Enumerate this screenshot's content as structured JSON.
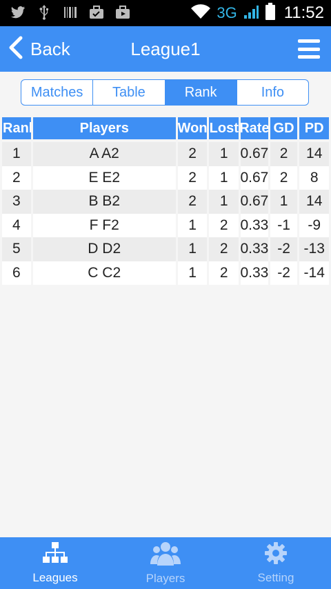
{
  "status_bar": {
    "network": "3G",
    "time": "11:52",
    "icons": [
      "twitter-icon",
      "usb-icon",
      "barcode-icon",
      "briefcase-check-icon",
      "briefcase-play-icon",
      "wifi-icon",
      "signal-icon",
      "battery-icon"
    ]
  },
  "header": {
    "back_label": "Back",
    "title": "League1"
  },
  "tabs": [
    {
      "label": "Matches",
      "active": false
    },
    {
      "label": "Table",
      "active": false
    },
    {
      "label": "Rank",
      "active": true
    },
    {
      "label": "Info",
      "active": false
    }
  ],
  "table": {
    "columns": [
      "Rank",
      "Players",
      "Won",
      "Lost",
      "Rate",
      "GD",
      "PD"
    ],
    "rows": [
      {
        "rank": "1",
        "player": "A A2",
        "won": "2",
        "lost": "1",
        "rate": "0.67",
        "gd": "2",
        "pd": "14"
      },
      {
        "rank": "2",
        "player": "E E2",
        "won": "2",
        "lost": "1",
        "rate": "0.67",
        "gd": "2",
        "pd": "8"
      },
      {
        "rank": "3",
        "player": "B B2",
        "won": "2",
        "lost": "1",
        "rate": "0.67",
        "gd": "1",
        "pd": "14"
      },
      {
        "rank": "4",
        "player": "F F2",
        "won": "1",
        "lost": "2",
        "rate": "0.33",
        "gd": "-1",
        "pd": "-9"
      },
      {
        "rank": "5",
        "player": "D D2",
        "won": "1",
        "lost": "2",
        "rate": "0.33",
        "gd": "-2",
        "pd": "-13"
      },
      {
        "rank": "6",
        "player": "C C2",
        "won": "1",
        "lost": "2",
        "rate": "0.33",
        "gd": "-2",
        "pd": "-14"
      }
    ]
  },
  "bottom_nav": [
    {
      "label": "Leagues",
      "icon": "hierarchy-icon",
      "active": true
    },
    {
      "label": "Players",
      "icon": "people-icon",
      "active": false
    },
    {
      "label": "Setting",
      "icon": "gear-icon",
      "active": false
    }
  ],
  "colors": {
    "primary": "#3e8ff4",
    "inactive_nav": "#b7d4fb",
    "row_alt": "#ececec"
  }
}
